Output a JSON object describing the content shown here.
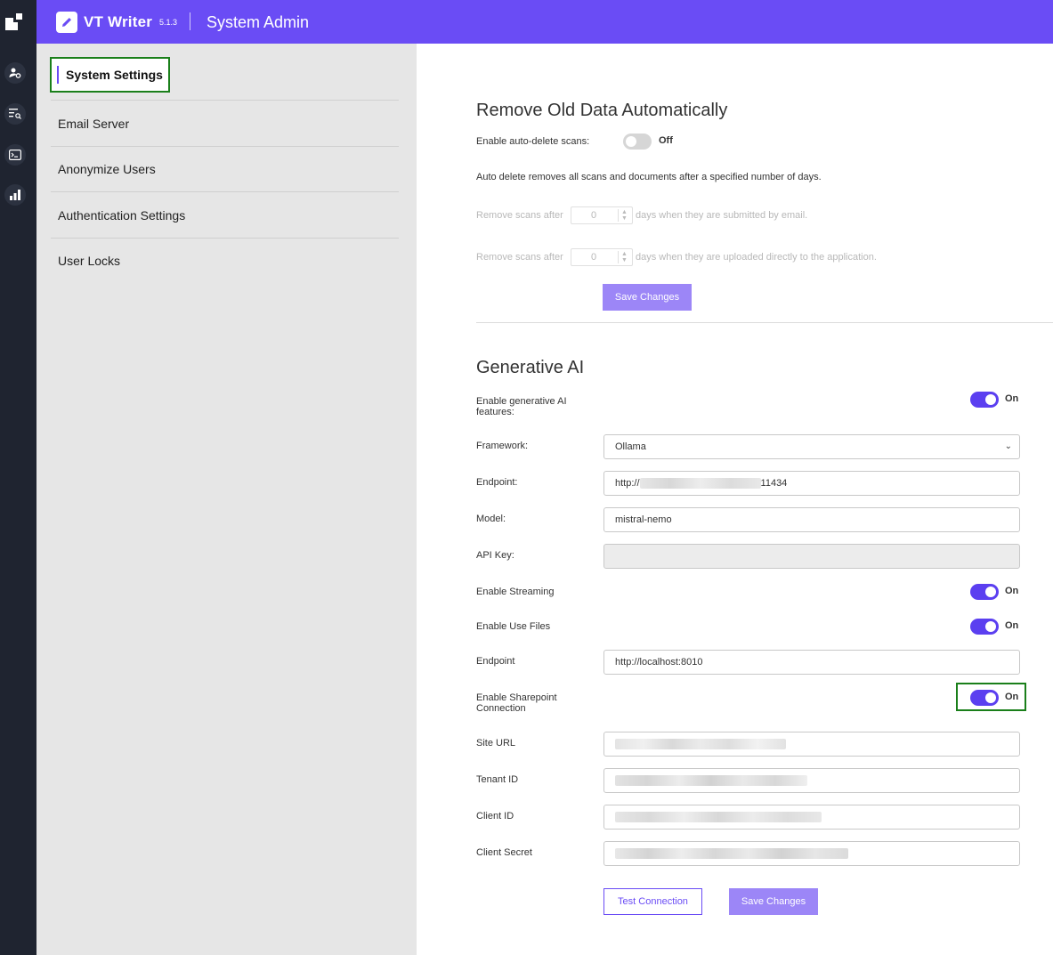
{
  "header": {
    "app_name": "VT Writer",
    "version": "5.1.3",
    "section_title": "System Admin"
  },
  "rail": {
    "icons": [
      "logo-icon",
      "user-settings-icon",
      "list-search-icon",
      "terminal-icon",
      "bar-chart-icon"
    ]
  },
  "nav": {
    "items": [
      {
        "label": "System Settings",
        "active": true
      },
      {
        "label": "Email Server"
      },
      {
        "label": "Anonymize Users"
      },
      {
        "label": "Authentication Settings"
      },
      {
        "label": "User Locks"
      }
    ]
  },
  "remove_old_data": {
    "title": "Remove Old Data Automatically",
    "auto_delete_label": "Enable auto-delete scans:",
    "auto_delete_state": "Off",
    "description": "Auto delete removes all scans and documents after a specified number of days.",
    "email_prefix": "Remove scans after",
    "email_value": "0",
    "email_suffix": "days when they are submitted by email.",
    "upload_prefix": "Remove scans after",
    "upload_value": "0",
    "upload_suffix": "days when they are uploaded directly to the application.",
    "save_label": "Save Changes"
  },
  "generative_ai": {
    "title": "Generative AI",
    "enable_label": "Enable generative AI features:",
    "enable_state": "On",
    "framework_label": "Framework:",
    "framework_value": "Ollama",
    "endpoint_label": "Endpoint:",
    "endpoint_prefix": "http://",
    "endpoint_suffix": "11434",
    "model_label": "Model:",
    "model_value": "mistral-nemo",
    "api_key_label": "API Key:",
    "api_key_value": "",
    "streaming_label": "Enable Streaming",
    "streaming_state": "On",
    "use_files_label": "Enable Use Files",
    "use_files_state": "On",
    "files_endpoint_label": "Endpoint",
    "files_endpoint_value": "http://localhost:8010",
    "sharepoint_label": "Enable Sharepoint Connection",
    "sharepoint_state": "On",
    "site_url_label": "Site URL",
    "tenant_id_label": "Tenant ID",
    "client_id_label": "Client ID",
    "client_secret_label": "Client Secret",
    "test_label": "Test Connection",
    "save_label": "Save Changes"
  },
  "colors": {
    "accent": "#6a4cf5",
    "toggle_on": "#5b3ff0",
    "button_primary": "#9c86f7",
    "highlight": "#1a7f1a",
    "rail_bg": "#1f2430",
    "nav_bg": "#e6e6e6"
  }
}
